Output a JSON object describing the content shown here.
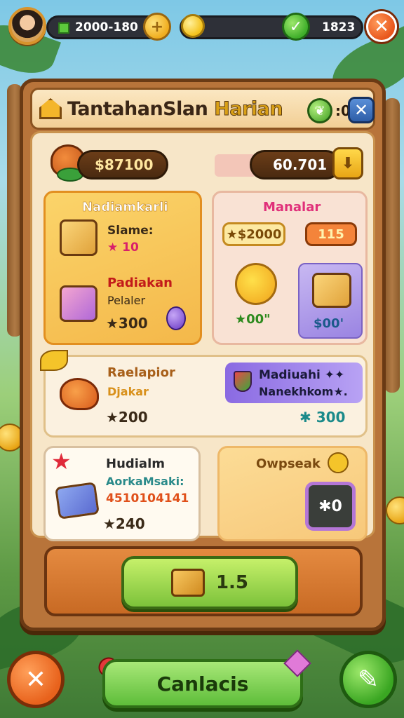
{
  "topbar": {
    "currency1": "2000-180",
    "currency2": "1823",
    "plus_icon": "+",
    "check_icon": "✓",
    "close_icon": "✕"
  },
  "panel": {
    "title_main": "TantahanSlan ",
    "title_highlight": "Harian",
    "head_value": ":0",
    "close_icon": "✕"
  },
  "stats": {
    "left": "$87100",
    "right": "60.701",
    "download_icon": "⬇"
  },
  "cards": {
    "card1": {
      "header": "Nadiamkarli",
      "label1": "Slame:",
      "value1": "★ 10",
      "label2": "Padiakan",
      "label3": "Pelaler",
      "value2": "★300"
    },
    "card2": {
      "header": "Manalar",
      "pill1": "★$2000",
      "pill2": "115",
      "value_left": "★00\"",
      "value_right": "$00'"
    },
    "card3": {
      "label1": "Raelapior",
      "label2": "Djakar",
      "value1": "★200",
      "banner1": "Madiuahi ✦✦",
      "banner2": "Nanekhkom★.",
      "value2": "✱ 300"
    },
    "card4": {
      "label1": "Hudialm",
      "label2": "AorkaMsaki:",
      "label3": "4510104141",
      "value": "★240"
    },
    "card5": {
      "label": "Owpseak",
      "badge": "✱0"
    }
  },
  "action": {
    "main_label": "1.5",
    "cancel_label": "Canlacis"
  },
  "colors": {
    "panel": "#b8743a",
    "accent_green": "#7cc23a",
    "accent_orange": "#e8621c"
  }
}
